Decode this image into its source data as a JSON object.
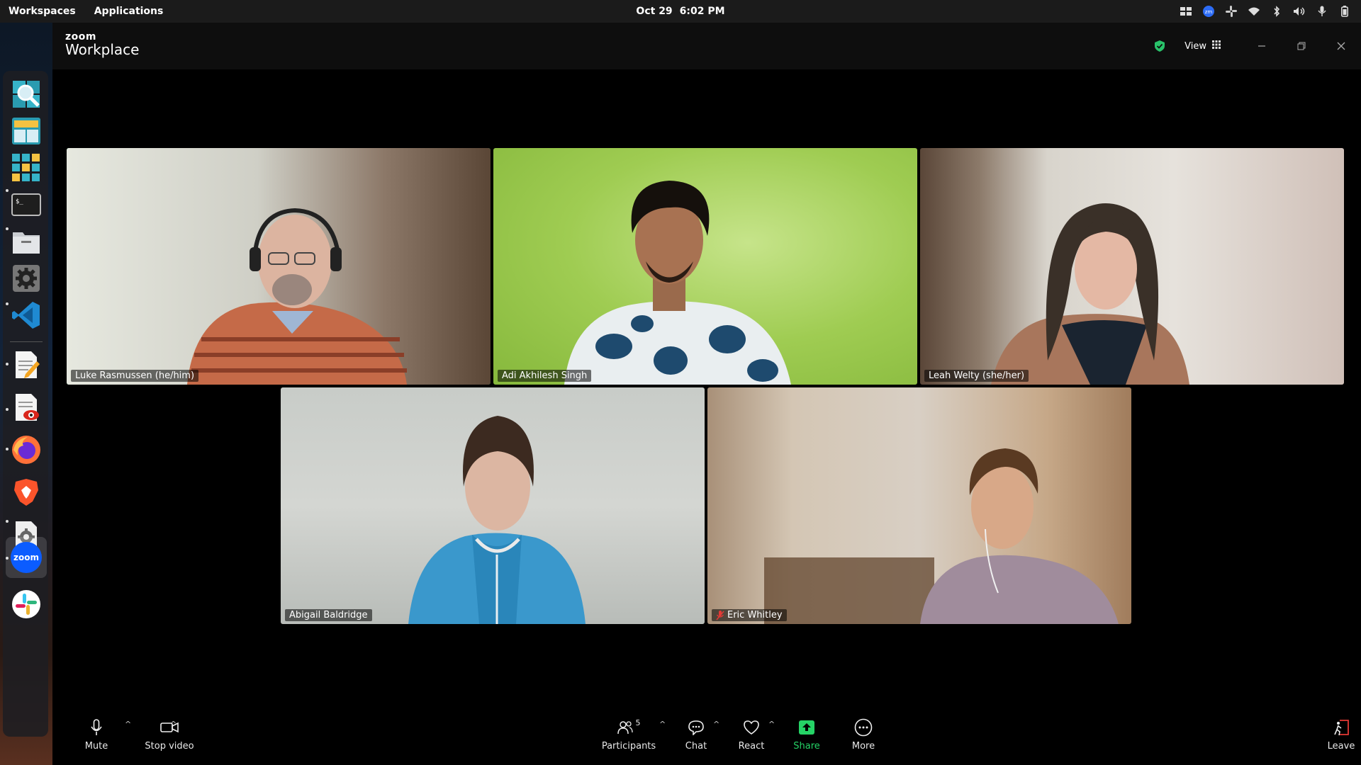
{
  "system_bar": {
    "workspaces": "Workspaces",
    "applications": "Applications",
    "date": "Oct 29",
    "time": "6:02 PM",
    "tray_icons": [
      "layout-icon",
      "zoom-tray-icon",
      "slack-tray-icon",
      "wifi-icon",
      "bluetooth-icon",
      "volume-icon",
      "microphone-icon",
      "battery-icon"
    ]
  },
  "dock": {
    "items": [
      "search-app-icon",
      "window-manager-icon",
      "app-grid-icon",
      "terminal-icon",
      "files-icon",
      "settings-icon",
      "vscode-icon",
      "text-editor-icon",
      "document-viewer-icon",
      "firefox-icon",
      "brave-icon",
      "system-settings-icon",
      "zoom-icon",
      "slack-icon"
    ],
    "zoom_label": "zoom"
  },
  "window": {
    "brand_small": "zoom",
    "brand_big": "Workplace",
    "view_label": "View",
    "accent": "#29c26a"
  },
  "participants": [
    {
      "name": "Luke Rasmussen (he/him)",
      "speaking": true,
      "muted": false
    },
    {
      "name": "Adi Akhilesh Singh",
      "speaking": false,
      "muted": false
    },
    {
      "name": "Leah Welty (she/her)",
      "speaking": false,
      "muted": false
    },
    {
      "name": "Abigail Baldridge",
      "speaking": false,
      "muted": false
    },
    {
      "name": "Eric Whitley",
      "speaking": false,
      "muted": true
    }
  ],
  "toolbar": {
    "mute": "Mute",
    "stop_video": "Stop video",
    "participants": "Participants",
    "participant_count": "5",
    "chat": "Chat",
    "react": "React",
    "share": "Share",
    "more": "More",
    "leave": "Leave",
    "share_color": "#25d366"
  }
}
